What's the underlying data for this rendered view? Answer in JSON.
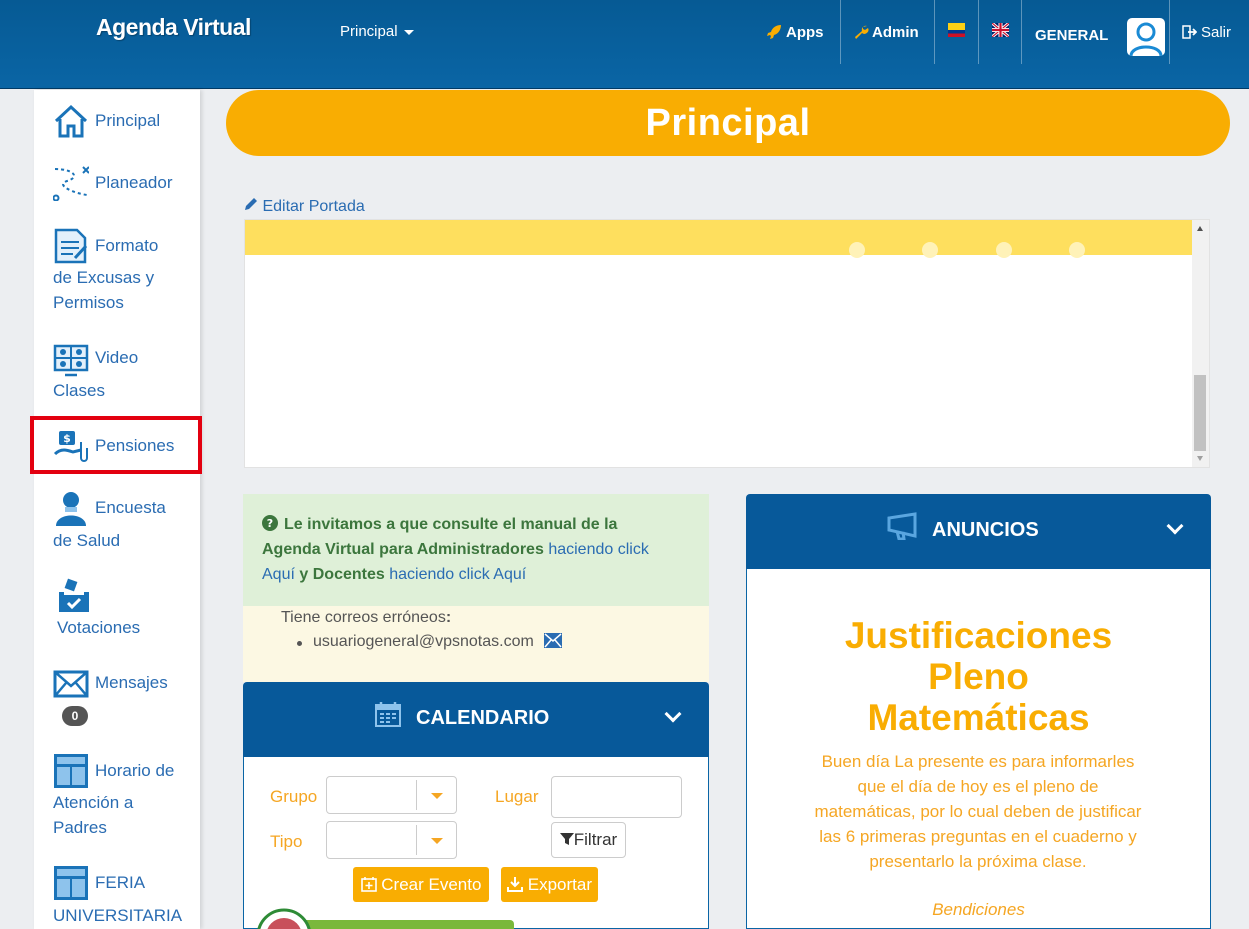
{
  "header": {
    "brand": "Agenda Virtual",
    "nav_principal": "Principal",
    "apps": "Apps",
    "admin": "Admin",
    "user": "GENERAL",
    "logout": "Salir"
  },
  "sidebar": {
    "items": [
      {
        "label": "Principal",
        "icon": "home-icon"
      },
      {
        "label": "Planeador",
        "icon": "route-icon"
      },
      {
        "label": "Formato",
        "label2": "de Excusas y",
        "label3": "Permisos",
        "icon": "document-icon"
      },
      {
        "label": "Video",
        "label2": "Clases",
        "icon": "video-call-icon"
      },
      {
        "label": "Pensiones",
        "icon": "payment-icon"
      },
      {
        "label": "Encuesta",
        "label2": "de Salud",
        "icon": "doctor-icon"
      },
      {
        "label": "Votaciones",
        "icon": "ballot-box-icon"
      },
      {
        "label": "Mensajes",
        "icon": "envelope-icon",
        "badge": "0"
      },
      {
        "label": "Horario de",
        "label2": "Atención a",
        "label3": "Padres",
        "icon": "layout-icon"
      },
      {
        "label": "FERIA",
        "label2": "UNIVERSITARIA",
        "icon": "layout-icon"
      }
    ]
  },
  "main": {
    "title": "Principal",
    "edit_cover": "Editar Portada",
    "manual": {
      "text1": "Le invitamos a que consulte el manual de la",
      "text2": "Agenda Virtual para Administradores",
      "link1": "haciendo click",
      "link1b": "Aquí",
      "and": "y",
      "docentes": "Docentes",
      "link2": "haciendo click Aquí"
    },
    "wrong_emails": {
      "title": "Tiene correos erróneos",
      "colon": ":",
      "email": "usuariogeneral@vpsnotas.com"
    }
  },
  "calendar": {
    "title": "CALENDARIO",
    "group_label": "Grupo",
    "place_label": "Lugar",
    "type_label": "Tipo",
    "filter_button": "Filtrar",
    "create_button": "Crear Evento",
    "export_button": "Exportar"
  },
  "announcements": {
    "title": "ANUNCIOS",
    "post_title_1": "Justificaciones",
    "post_title_2": "Pleno",
    "post_title_3": "Matemáticas",
    "body_1": "Buen día La presente es para informarles",
    "body_2": "que el día de hoy es el pleno de",
    "body_3": "matemáticas, por lo cual deben de justificar",
    "body_4": "las 6 primeras preguntas en el cuaderno y",
    "body_5": "presentarlo la próxima clase.",
    "sign": "Bendiciones"
  },
  "colors": {
    "header_blue": "#07599a",
    "accent_orange": "#f9ad02",
    "link_blue": "#2a6cb2",
    "highlight_red": "#e30010"
  }
}
